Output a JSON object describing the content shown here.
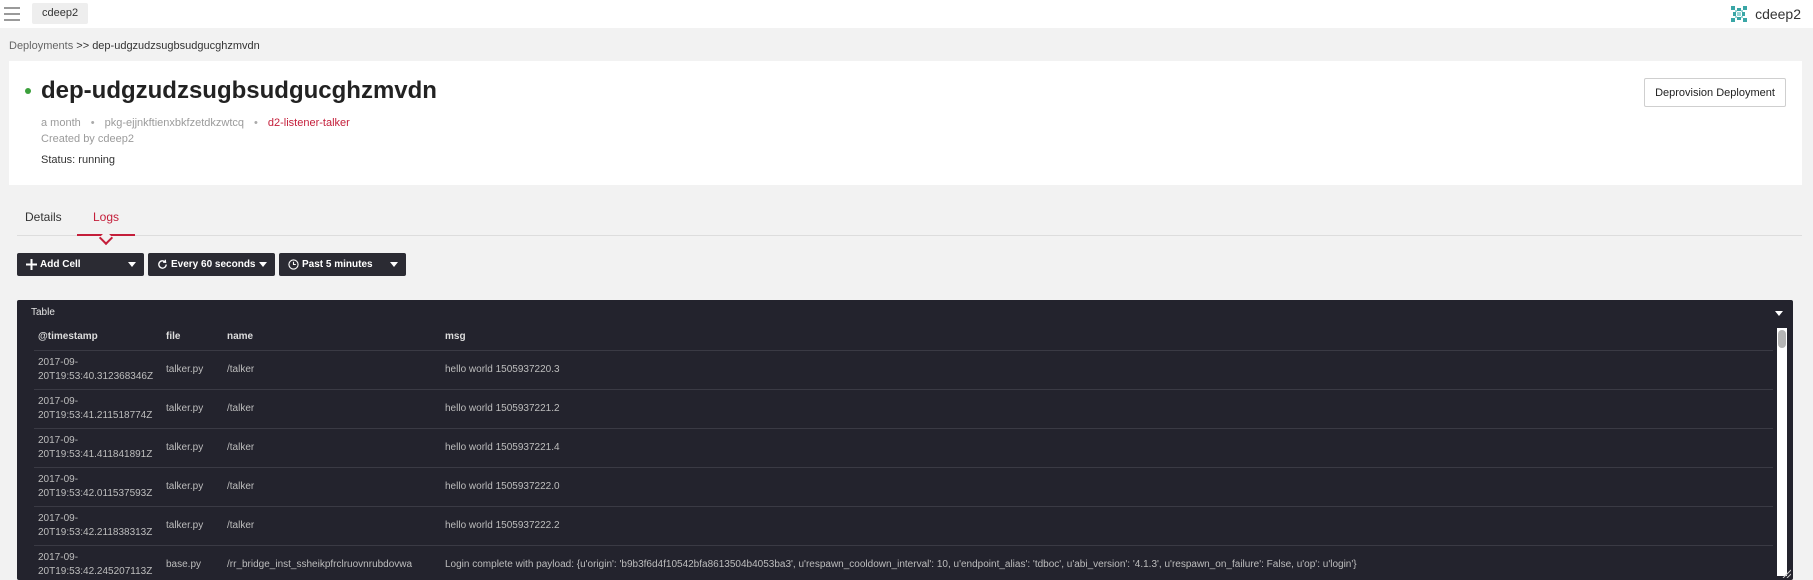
{
  "topbar": {
    "org": "cdeep2",
    "user_name": "cdeep2"
  },
  "breadcrumb": {
    "root": "Deployments",
    "separator": ">>",
    "current": "dep-udgzudzsugbsudgucghzmvdn"
  },
  "deployment": {
    "name": "dep-udgzudzsugbsudgucghzmvdn",
    "age": "a month",
    "package": "pkg-ejjnkftienxbkfzetdkzwtcq",
    "package_link": "d2-listener-talker",
    "created_by": "Created by cdeep2",
    "status": "Status: running",
    "status_color": "#3ba03b",
    "deprovision_label": "Deprovision Deployment"
  },
  "tabs": [
    {
      "label": "Details",
      "active": false
    },
    {
      "label": "Logs",
      "active": true
    }
  ],
  "accent_color": "#c41e3a",
  "toolbar": {
    "add_cell": "Add Cell",
    "refresh": "Every 60 seconds",
    "range": "Past 5 minutes"
  },
  "panel": {
    "title": "Table",
    "columns": [
      "@timestamp",
      "file",
      "name",
      "msg"
    ],
    "rows": [
      {
        "ts": "2017-09-20T19:53:40.312368346Z",
        "file": "talker.py",
        "name": "/talker",
        "msg": "hello world 1505937220.3"
      },
      {
        "ts": "2017-09-20T19:53:41.211518774Z",
        "file": "talker.py",
        "name": "/talker",
        "msg": "hello world 1505937221.2"
      },
      {
        "ts": "2017-09-20T19:53:41.411841891Z",
        "file": "talker.py",
        "name": "/talker",
        "msg": "hello world 1505937221.4"
      },
      {
        "ts": "2017-09-20T19:53:42.011537593Z",
        "file": "talker.py",
        "name": "/talker",
        "msg": "hello world 1505937222.0"
      },
      {
        "ts": "2017-09-20T19:53:42.211838313Z",
        "file": "talker.py",
        "name": "/talker",
        "msg": "hello world 1505937222.2"
      },
      {
        "ts": "2017-09-20T19:53:42.245207113Z",
        "file": "base.py",
        "name": "/rr_bridge_inst_ssheikpfrclruovnrubdovwa",
        "msg": "Login complete with payload: {u'origin': 'b9b3f6d4f10542bfa8613504b4053ba3', u'respawn_cooldown_interval': 10, u'endpoint_alias': 'tdboc', u'abi_version': '4.1.3', u'respawn_on_failure': False, u'op': u'login'}"
      }
    ]
  }
}
